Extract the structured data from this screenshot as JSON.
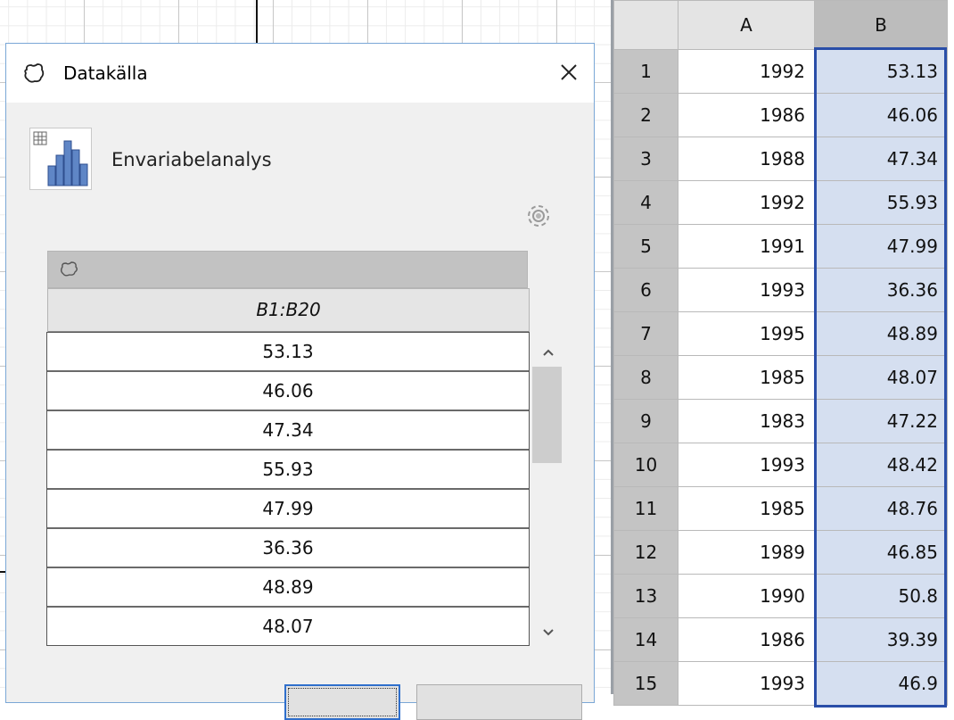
{
  "dialog": {
    "title": "Datakälla",
    "tool_label": "Envariabelanalys",
    "source_range": "B1:B20",
    "values": [
      "53.13",
      "46.06",
      "47.34",
      "55.93",
      "47.99",
      "36.36",
      "48.89",
      "48.07"
    ]
  },
  "spreadsheet": {
    "columns": [
      "A",
      "B"
    ],
    "rows": [
      {
        "n": "1",
        "a": "1992",
        "b": "53.13"
      },
      {
        "n": "2",
        "a": "1986",
        "b": "46.06"
      },
      {
        "n": "3",
        "a": "1988",
        "b": "47.34"
      },
      {
        "n": "4",
        "a": "1992",
        "b": "55.93"
      },
      {
        "n": "5",
        "a": "1991",
        "b": "47.99"
      },
      {
        "n": "6",
        "a": "1993",
        "b": "36.36"
      },
      {
        "n": "7",
        "a": "1995",
        "b": "48.89"
      },
      {
        "n": "8",
        "a": "1985",
        "b": "48.07"
      },
      {
        "n": "9",
        "a": "1983",
        "b": "47.22"
      },
      {
        "n": "10",
        "a": "1993",
        "b": "48.42"
      },
      {
        "n": "11",
        "a": "1985",
        "b": "48.76"
      },
      {
        "n": "12",
        "a": "1989",
        "b": "46.85"
      },
      {
        "n": "13",
        "a": "1990",
        "b": "50.8"
      },
      {
        "n": "14",
        "a": "1986",
        "b": "39.39"
      },
      {
        "n": "15",
        "a": "1993",
        "b": "46.9"
      }
    ],
    "selection_color": "#2a4ea8",
    "selection_fill": "#d5dff0"
  },
  "icons": {
    "title": "freehand-shape-icon",
    "close": "close-icon",
    "tool": "histogram-icon",
    "settings": "gear-icon",
    "source": "freehand-shape-icon"
  }
}
